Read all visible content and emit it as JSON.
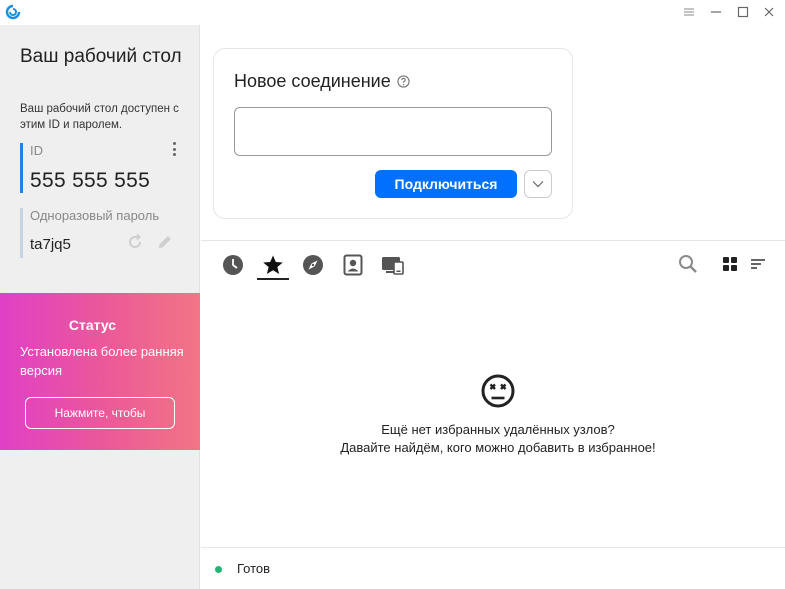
{
  "window": {
    "logo_icon": "rustdesk-logo-icon",
    "controls": [
      "menu-icon",
      "minimize-icon",
      "maximize-icon",
      "close-icon"
    ]
  },
  "sidebar": {
    "title": "Ваш рабочий стол",
    "description": "Ваш рабочий стол доступен с этим ID и паролем.",
    "id_label": "ID",
    "id_value": "555 555 555",
    "password_label": "Одноразовый пароль",
    "password_value": "ta7jq5",
    "status": {
      "title": "Статус",
      "text": "Установлена более ранняя версия",
      "button_label": "Нажмите, чтобы"
    }
  },
  "connection": {
    "title": "Новое соединение",
    "input_value": "",
    "connect_label": "Подключиться"
  },
  "tabs": [
    {
      "name": "recent-sessions-tab",
      "icon": "clock-icon"
    },
    {
      "name": "favorites-tab",
      "icon": "star-icon",
      "active": true
    },
    {
      "name": "discovered-tab",
      "icon": "compass-icon"
    },
    {
      "name": "address-book-tab",
      "icon": "contact-book-icon"
    },
    {
      "name": "group-tab",
      "icon": "devices-icon"
    }
  ],
  "empty_state": {
    "line1": "Ещё нет избранных удалённых узлов?",
    "line2": "Давайте найдём, кого можно добавить в избранное!"
  },
  "footer": {
    "status_text": "Готов",
    "status_color": "#22b573"
  },
  "colors": {
    "accent": "#0071ff",
    "id_bar": "#2a7de1"
  }
}
